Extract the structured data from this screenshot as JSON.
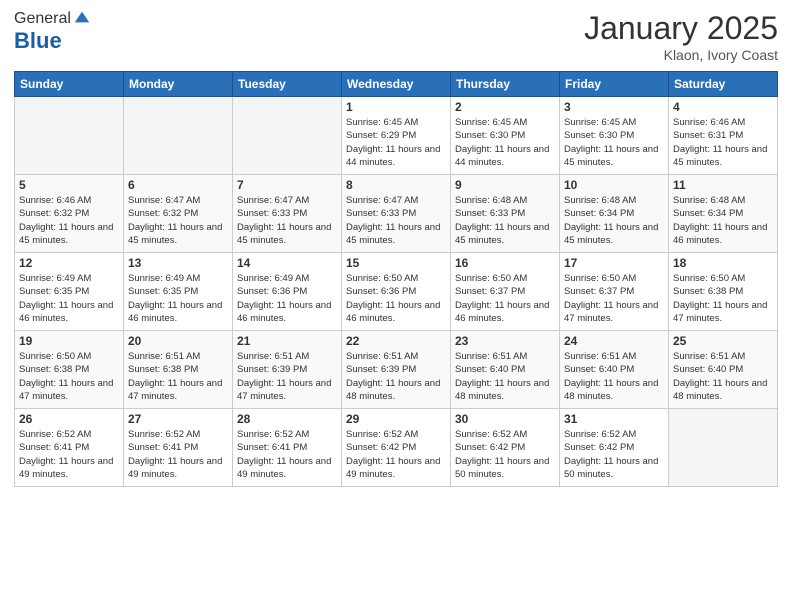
{
  "header": {
    "logo_line1": "General",
    "logo_line2": "Blue",
    "month": "January 2025",
    "location": "Klaon, Ivory Coast"
  },
  "weekdays": [
    "Sunday",
    "Monday",
    "Tuesday",
    "Wednesday",
    "Thursday",
    "Friday",
    "Saturday"
  ],
  "weeks": [
    [
      {
        "day": "",
        "info": ""
      },
      {
        "day": "",
        "info": ""
      },
      {
        "day": "",
        "info": ""
      },
      {
        "day": "1",
        "info": "Sunrise: 6:45 AM\nSunset: 6:29 PM\nDaylight: 11 hours and 44 minutes."
      },
      {
        "day": "2",
        "info": "Sunrise: 6:45 AM\nSunset: 6:30 PM\nDaylight: 11 hours and 44 minutes."
      },
      {
        "day": "3",
        "info": "Sunrise: 6:45 AM\nSunset: 6:30 PM\nDaylight: 11 hours and 45 minutes."
      },
      {
        "day": "4",
        "info": "Sunrise: 6:46 AM\nSunset: 6:31 PM\nDaylight: 11 hours and 45 minutes."
      }
    ],
    [
      {
        "day": "5",
        "info": "Sunrise: 6:46 AM\nSunset: 6:32 PM\nDaylight: 11 hours and 45 minutes."
      },
      {
        "day": "6",
        "info": "Sunrise: 6:47 AM\nSunset: 6:32 PM\nDaylight: 11 hours and 45 minutes."
      },
      {
        "day": "7",
        "info": "Sunrise: 6:47 AM\nSunset: 6:33 PM\nDaylight: 11 hours and 45 minutes."
      },
      {
        "day": "8",
        "info": "Sunrise: 6:47 AM\nSunset: 6:33 PM\nDaylight: 11 hours and 45 minutes."
      },
      {
        "day": "9",
        "info": "Sunrise: 6:48 AM\nSunset: 6:33 PM\nDaylight: 11 hours and 45 minutes."
      },
      {
        "day": "10",
        "info": "Sunrise: 6:48 AM\nSunset: 6:34 PM\nDaylight: 11 hours and 45 minutes."
      },
      {
        "day": "11",
        "info": "Sunrise: 6:48 AM\nSunset: 6:34 PM\nDaylight: 11 hours and 46 minutes."
      }
    ],
    [
      {
        "day": "12",
        "info": "Sunrise: 6:49 AM\nSunset: 6:35 PM\nDaylight: 11 hours and 46 minutes."
      },
      {
        "day": "13",
        "info": "Sunrise: 6:49 AM\nSunset: 6:35 PM\nDaylight: 11 hours and 46 minutes."
      },
      {
        "day": "14",
        "info": "Sunrise: 6:49 AM\nSunset: 6:36 PM\nDaylight: 11 hours and 46 minutes."
      },
      {
        "day": "15",
        "info": "Sunrise: 6:50 AM\nSunset: 6:36 PM\nDaylight: 11 hours and 46 minutes."
      },
      {
        "day": "16",
        "info": "Sunrise: 6:50 AM\nSunset: 6:37 PM\nDaylight: 11 hours and 46 minutes."
      },
      {
        "day": "17",
        "info": "Sunrise: 6:50 AM\nSunset: 6:37 PM\nDaylight: 11 hours and 47 minutes."
      },
      {
        "day": "18",
        "info": "Sunrise: 6:50 AM\nSunset: 6:38 PM\nDaylight: 11 hours and 47 minutes."
      }
    ],
    [
      {
        "day": "19",
        "info": "Sunrise: 6:50 AM\nSunset: 6:38 PM\nDaylight: 11 hours and 47 minutes."
      },
      {
        "day": "20",
        "info": "Sunrise: 6:51 AM\nSunset: 6:38 PM\nDaylight: 11 hours and 47 minutes."
      },
      {
        "day": "21",
        "info": "Sunrise: 6:51 AM\nSunset: 6:39 PM\nDaylight: 11 hours and 47 minutes."
      },
      {
        "day": "22",
        "info": "Sunrise: 6:51 AM\nSunset: 6:39 PM\nDaylight: 11 hours and 48 minutes."
      },
      {
        "day": "23",
        "info": "Sunrise: 6:51 AM\nSunset: 6:40 PM\nDaylight: 11 hours and 48 minutes."
      },
      {
        "day": "24",
        "info": "Sunrise: 6:51 AM\nSunset: 6:40 PM\nDaylight: 11 hours and 48 minutes."
      },
      {
        "day": "25",
        "info": "Sunrise: 6:51 AM\nSunset: 6:40 PM\nDaylight: 11 hours and 48 minutes."
      }
    ],
    [
      {
        "day": "26",
        "info": "Sunrise: 6:52 AM\nSunset: 6:41 PM\nDaylight: 11 hours and 49 minutes."
      },
      {
        "day": "27",
        "info": "Sunrise: 6:52 AM\nSunset: 6:41 PM\nDaylight: 11 hours and 49 minutes."
      },
      {
        "day": "28",
        "info": "Sunrise: 6:52 AM\nSunset: 6:41 PM\nDaylight: 11 hours and 49 minutes."
      },
      {
        "day": "29",
        "info": "Sunrise: 6:52 AM\nSunset: 6:42 PM\nDaylight: 11 hours and 49 minutes."
      },
      {
        "day": "30",
        "info": "Sunrise: 6:52 AM\nSunset: 6:42 PM\nDaylight: 11 hours and 50 minutes."
      },
      {
        "day": "31",
        "info": "Sunrise: 6:52 AM\nSunset: 6:42 PM\nDaylight: 11 hours and 50 minutes."
      },
      {
        "day": "",
        "info": ""
      }
    ]
  ]
}
